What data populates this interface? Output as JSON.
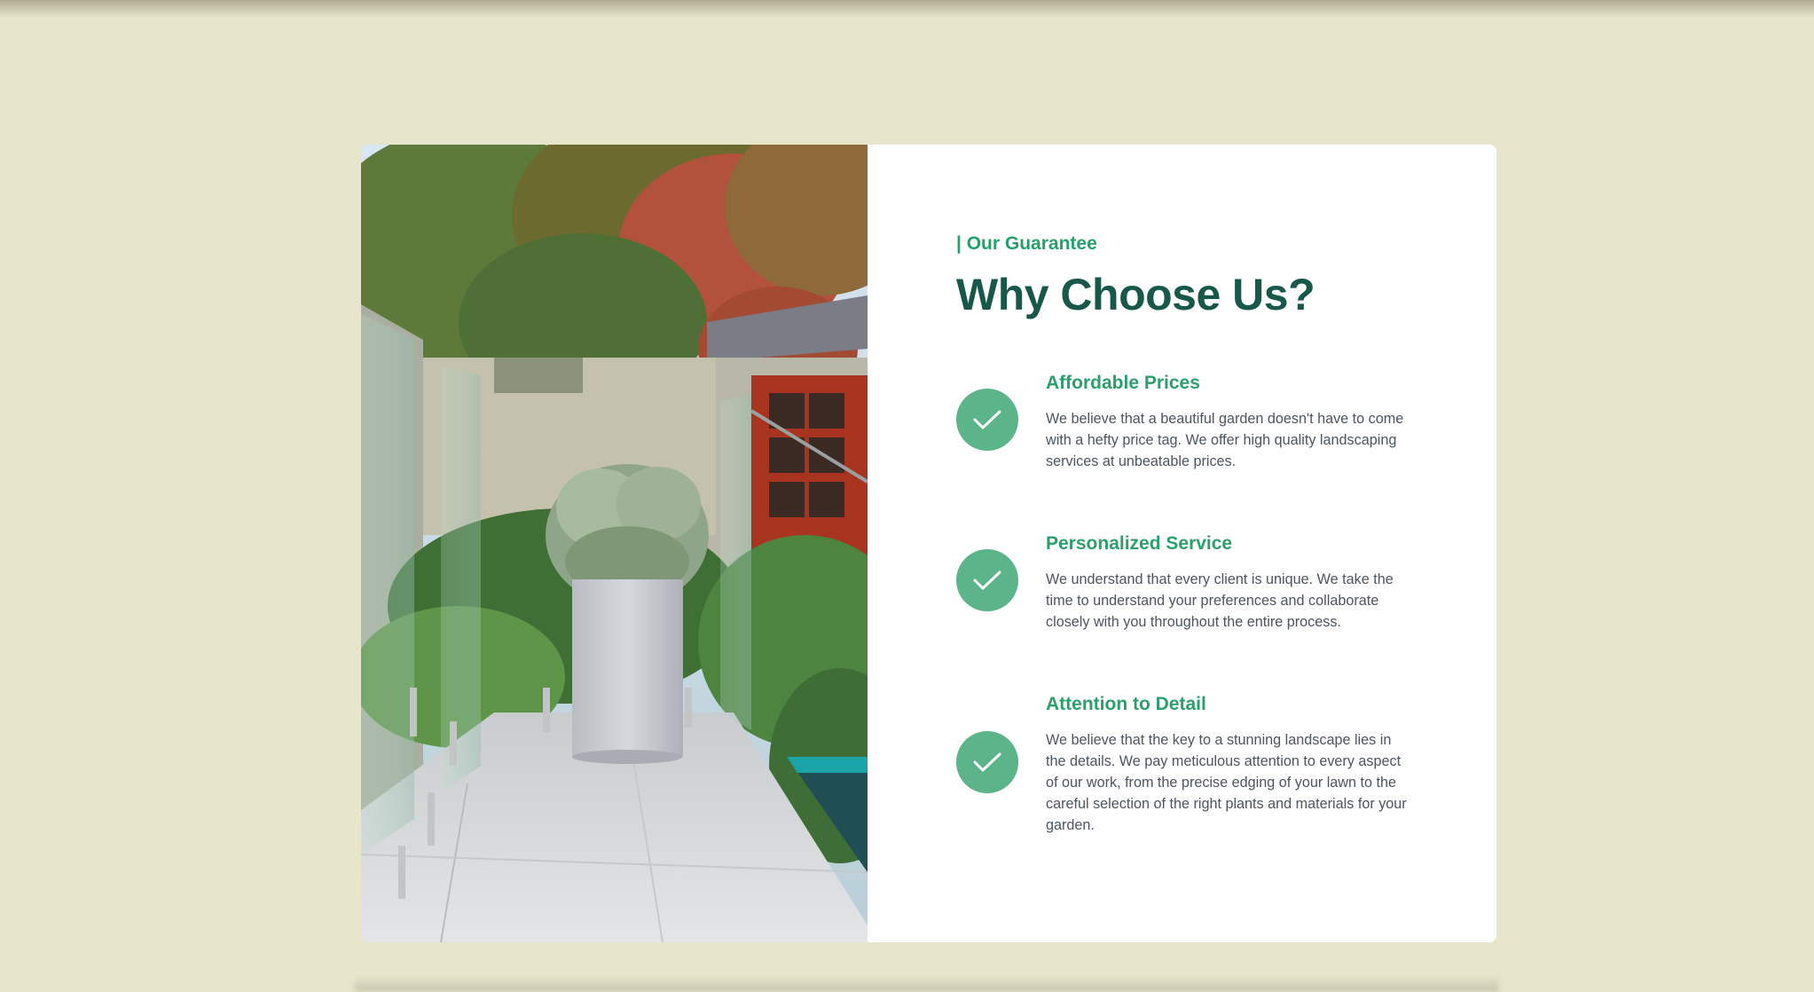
{
  "section": {
    "eyebrow": "| Our Guarantee",
    "title": "Why Choose Us?"
  },
  "features": [
    {
      "title": "Affordable Prices",
      "description": "We believe that a beautiful garden doesn't have to come with a hefty price tag. We offer high quality landscaping services at unbeatable prices.",
      "icon": "check-icon"
    },
    {
      "title": "Personalized Service",
      "description": "We understand that every client is unique. We take the time to understand your preferences and collaborate closely with you throughout the entire process.",
      "icon": "check-icon"
    },
    {
      "title": "Attention to Detail",
      "description": "We believe that the key to a stunning landscape lies in the details. We pay meticulous attention to every aspect of our work, from the precise edging of your lawn to the careful selection of the right plants and materials for your garden.",
      "icon": "check-icon"
    }
  ],
  "colors": {
    "page_background": "#e8e5cd",
    "accent_green": "#26a06a",
    "heading_dark_green": "#17584a",
    "check_circle": "#5bb48a",
    "body_text": "#4c5560"
  }
}
